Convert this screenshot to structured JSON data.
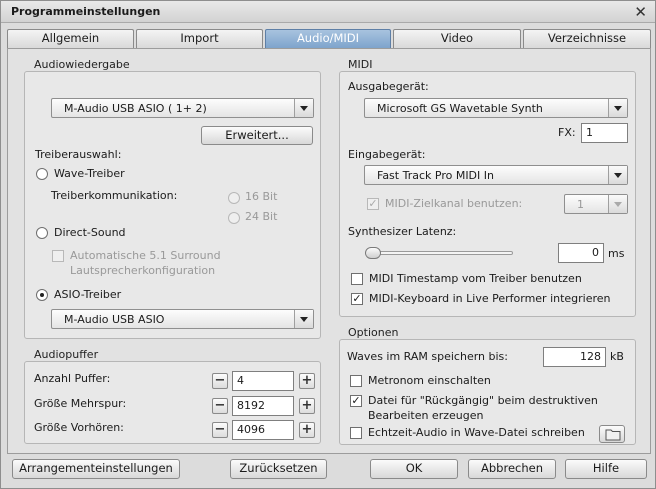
{
  "window": {
    "title": "Programmeinstellungen"
  },
  "tabs": [
    {
      "label": "Allgemein",
      "active": false
    },
    {
      "label": "Import",
      "active": false
    },
    {
      "label": "Audio/MIDI",
      "active": true
    },
    {
      "label": "Video",
      "active": false
    },
    {
      "label": "Verzeichnisse",
      "active": false
    }
  ],
  "audiowiedergabe": {
    "title": "Audiowiedergabe",
    "device": "M-Audio USB ASIO ( 1+ 2)",
    "advanced_button": "Erweitert...",
    "driver_label": "Treiberauswahl:",
    "wave_driver": "Wave-Treiber",
    "driver_comm_label": "Treiberkommunikation:",
    "bit16": "16 Bit",
    "bit24": "24 Bit",
    "direct_sound": "Direct-Sound",
    "auto_surround_line1": "Automatische 5.1 Surround",
    "auto_surround_line2": "Lautsprecherkonfiguration",
    "asio_driver": "ASIO-Treiber",
    "asio_device": "M-Audio USB ASIO",
    "selected_driver": "ASIO-Treiber"
  },
  "audiopuffer": {
    "title": "Audiopuffer",
    "rows": [
      {
        "label": "Anzahl Puffer:",
        "value": "4"
      },
      {
        "label": "Größe Mehrspur:",
        "value": "8192"
      },
      {
        "label": "Größe Vorhören:",
        "value": "4096"
      }
    ]
  },
  "midi": {
    "title": "MIDI",
    "output_label": "Ausgabegerät:",
    "output_device": "Microsoft GS Wavetable Synth",
    "fx_label": "FX:",
    "fx_value": "1",
    "input_label": "Eingabegerät:",
    "input_device": "Fast Track Pro MIDI In",
    "target_channel_label": "MIDI-Zielkanal benutzen:",
    "target_channel_checked": true,
    "target_channel_value": "1",
    "latency_label": "Synthesizer Latenz:",
    "latency_value": "0",
    "latency_unit": "ms",
    "latency_slider_fraction": 0,
    "timestamp_label": "MIDI Timestamp vom Treiber benutzen",
    "timestamp_checked": false,
    "keyboard_label": "MIDI-Keyboard in Live Performer integrieren",
    "keyboard_checked": true
  },
  "optionen": {
    "title": "Optionen",
    "waves_label": "Waves im RAM speichern bis:",
    "waves_value": "128",
    "waves_unit": "kB",
    "metronom_label": "Metronom einschalten",
    "metronom_checked": false,
    "undo_line1": "Datei für \"Rückgängig\" beim destruktiven",
    "undo_line2": "Bearbeiten erzeugen",
    "undo_checked": true,
    "realtime_label": "Echtzeit-Audio in Wave-Datei schreiben",
    "realtime_checked": false
  },
  "footer": {
    "arrangement": "Arrangementeinstellungen",
    "reset": "Zurücksetzen",
    "ok": "OK",
    "cancel": "Abbrechen",
    "help": "Hilfe"
  },
  "icons": {
    "close": "close-icon",
    "dropdown": "chevron-down-icon",
    "folder": "folder-icon",
    "check": "checkmark-icon"
  }
}
